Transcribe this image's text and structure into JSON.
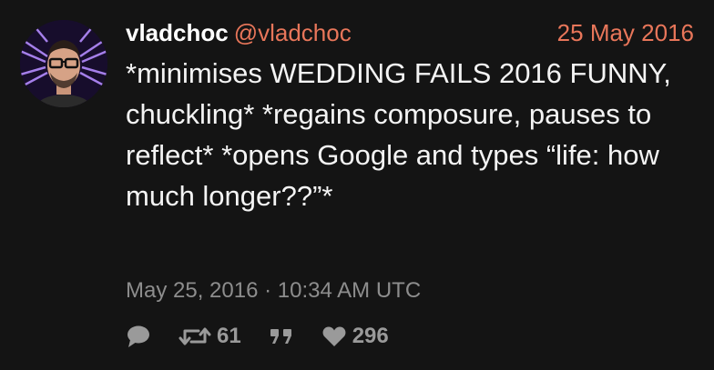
{
  "tweet": {
    "display_name": "vladchoc",
    "handle": "@vladchoc",
    "date": "25 May 2016",
    "text": "*minimises WEDDING FAILS 2016 FUNNY, chuckling* *regains composure, pauses to reflect* *opens Google and types “life: how much longer??”*",
    "timestamp": "May 25, 2016 · 10:34 AM UTC",
    "retweet_count": "61",
    "like_count": "296"
  },
  "colors": {
    "background": "#141414",
    "accent": "#e8765a",
    "muted": "#8d8d8d"
  },
  "icons": {
    "reply": "speech-bubble-icon",
    "retweet": "retweet-icon",
    "quote": "quote-icon",
    "like": "heart-icon"
  }
}
